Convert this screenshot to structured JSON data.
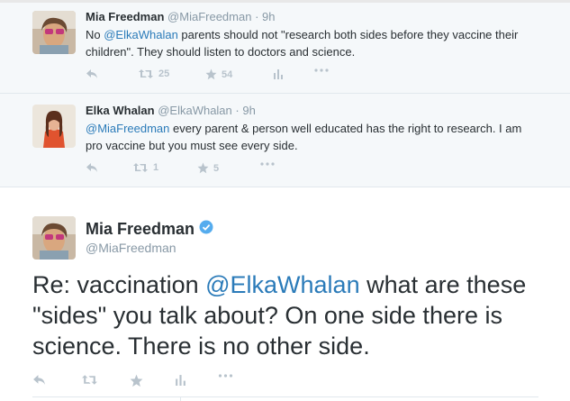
{
  "colors": {
    "link": "#2b7bb9",
    "muted": "#8899a6",
    "icon": "#b8c3cc",
    "verified": "#55acee",
    "reply_bg": "#f5f8fa"
  },
  "reply1": {
    "name": "Mia Freedman",
    "handle": "@MiaFreedman",
    "time": "· 9h",
    "text_pre": "No ",
    "mention": "@ElkaWhalan",
    "text_post": " parents should not \"research both sides before they vaccine their children\". They should listen to doctors and science.",
    "retweets": "25",
    "favorites": "54",
    "icons": [
      "reply-icon",
      "retweet-icon",
      "favorite-icon",
      "analytics-icon",
      "more-icon"
    ]
  },
  "reply2": {
    "name": "Elka Whalan",
    "handle": "@ElkaWhalan",
    "time": "· 9h",
    "mention": "@MiaFreedman",
    "text_post": " every parent & person well educated has the right to research. I am pro vaccine but you must see every side.",
    "retweets": "1",
    "favorites": "5",
    "icons": [
      "reply-icon",
      "retweet-icon",
      "favorite-icon",
      "more-icon"
    ]
  },
  "main": {
    "name": "Mia Freedman",
    "handle": "@MiaFreedman",
    "verified_icon": "verified-badge-icon",
    "text_pre": "Re: vaccination ",
    "mention": "@ElkaWhalan",
    "text_post": " what are these \"sides\" you talk about? On one side there is science. There is no other side.",
    "icons": [
      "reply-icon",
      "retweet-icon",
      "favorite-icon",
      "analytics-icon",
      "more-icon"
    ]
  }
}
